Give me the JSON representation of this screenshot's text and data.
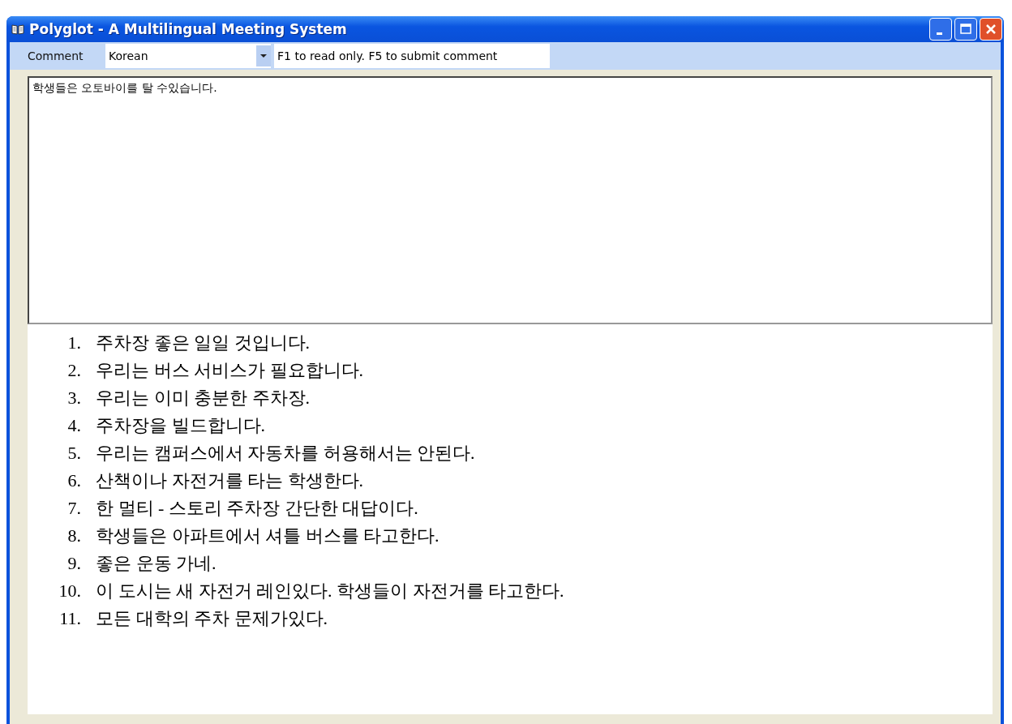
{
  "window": {
    "title": "Polyglot - A Multilingual Meeting System"
  },
  "toolbar": {
    "label": "Comment",
    "language": "Korean",
    "hint": "F1 to read only. F5 to submit comment"
  },
  "comment_box": {
    "value": "학생들은 오토바이를 탈 수있습니다."
  },
  "comments": [
    {
      "number": "1.",
      "text": "주차장 좋은 일일 것입니다."
    },
    {
      "number": "2.",
      "text": "우리는 버스 서비스가 필요합니다."
    },
    {
      "number": "3.",
      "text": "우리는 이미 충분한 주차장."
    },
    {
      "number": "4.",
      "text": "주차장을 빌드합니다."
    },
    {
      "number": "5.",
      "text": "우리는 캠퍼스에서 자동차를 허용해서는 안된다."
    },
    {
      "number": "6.",
      "text": "산책이나 자전거를 타는 학생한다."
    },
    {
      "number": "7.",
      "text": "한 멀티 - 스토리 주차장 간단한 대답이다."
    },
    {
      "number": "8.",
      "text": "학생들은 아파트에서 셔틀 버스를 타고한다."
    },
    {
      "number": "9.",
      "text": "좋은 운동 가네."
    },
    {
      "number": "10.",
      "text": "이 도시는 새 자전거 레인있다.  학생들이 자전거를 타고한다."
    },
    {
      "number": "11.",
      "text": "모든 대학의 주차 문제가있다."
    }
  ]
}
